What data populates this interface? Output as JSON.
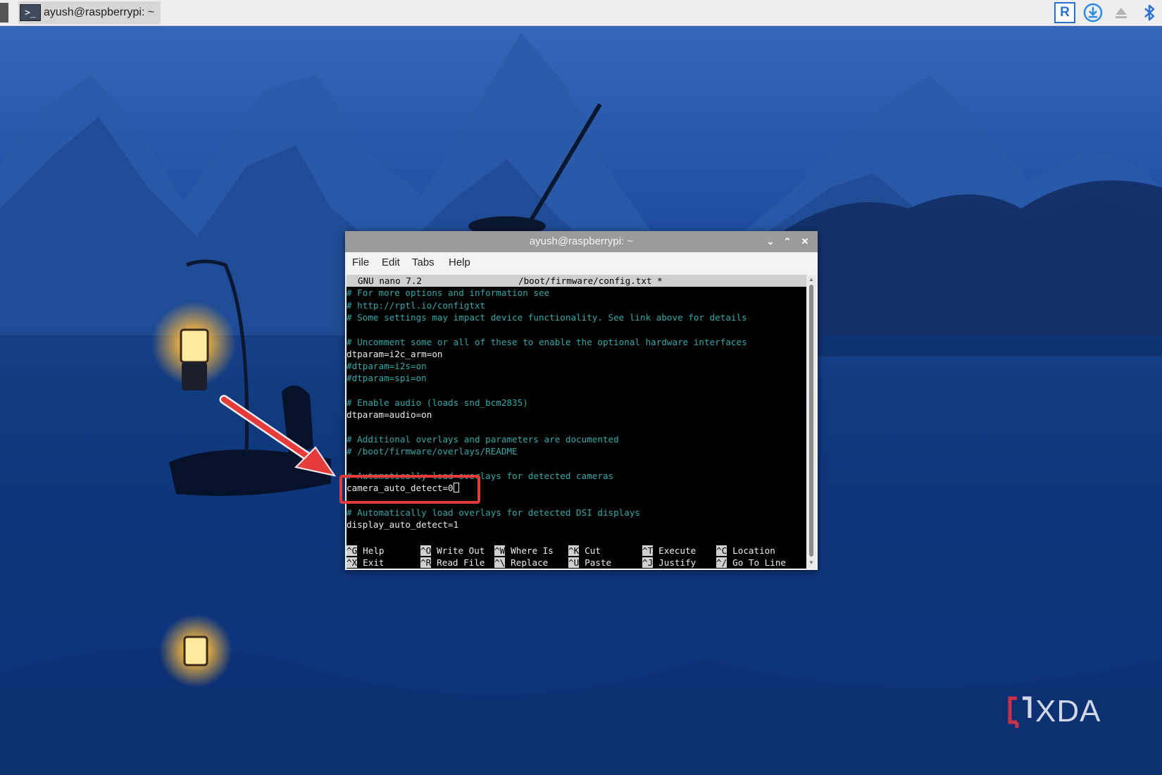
{
  "taskbar": {
    "task_label": "ayush@raspberrypi: ~",
    "task_icon_glyph": ">_",
    "tray_icons": [
      "vnc-icon",
      "updater-icon",
      "eject-icon",
      "bluetooth-icon"
    ],
    "vnc_glyph": "R"
  },
  "window": {
    "title": "ayush@raspberrypi: ~",
    "controls": {
      "minimize": "⌄",
      "maximize": "⌃",
      "close": "✕"
    },
    "menu": [
      "File",
      "Edit",
      "Tabs",
      "Help"
    ]
  },
  "nano": {
    "header_left": "GNU nano 7.2",
    "header_file": "/boot/firmware/config.txt *",
    "lines": [
      {
        "text": "# For more options and information see",
        "type": "comment"
      },
      {
        "text": "# http://rptl.io/configtxt",
        "type": "comment"
      },
      {
        "text": "# Some settings may impact device functionality. See link above for details",
        "type": "comment"
      },
      {
        "text": "",
        "type": "blank"
      },
      {
        "text": "# Uncomment some or all of these to enable the optional hardware interfaces",
        "type": "comment"
      },
      {
        "text": "dtparam=i2c_arm=on",
        "type": "code"
      },
      {
        "text": "#dtparam=i2s=on",
        "type": "comment"
      },
      {
        "text": "#dtparam=spi=on",
        "type": "comment"
      },
      {
        "text": "",
        "type": "blank"
      },
      {
        "text": "# Enable audio (loads snd_bcm2835)",
        "type": "comment"
      },
      {
        "text": "dtparam=audio=on",
        "type": "code"
      },
      {
        "text": "",
        "type": "blank"
      },
      {
        "text": "# Additional overlays and parameters are documented",
        "type": "comment"
      },
      {
        "text": "# /boot/firmware/overlays/README",
        "type": "comment"
      },
      {
        "text": "",
        "type": "blank"
      },
      {
        "text": "# Automatically load overlays for detected cameras",
        "type": "comment"
      },
      {
        "text": "camera_auto_detect=0",
        "type": "code"
      },
      {
        "text": "",
        "type": "blank"
      },
      {
        "text": "# Automatically load overlays for detected DSI displays",
        "type": "comment"
      },
      {
        "text": "display_auto_detect=1",
        "type": "code"
      }
    ],
    "shortcuts": [
      {
        "key": "^G",
        "label": "Help"
      },
      {
        "key": "^O",
        "label": "Write Out"
      },
      {
        "key": "^W",
        "label": "Where Is"
      },
      {
        "key": "^K",
        "label": "Cut"
      },
      {
        "key": "^T",
        "label": "Execute"
      },
      {
        "key": "^C",
        "label": "Location"
      },
      {
        "key": "^X",
        "label": "Exit"
      },
      {
        "key": "^R",
        "label": "Read File"
      },
      {
        "key": "^\\",
        "label": "Replace"
      },
      {
        "key": "^U",
        "label": "Paste"
      },
      {
        "key": "^J",
        "label": "Justify"
      },
      {
        "key": "^/",
        "label": "Go To Line"
      }
    ]
  },
  "watermark": {
    "text": "XDA"
  },
  "colors": {
    "comment": "#35a8a8",
    "highlight": "#e53b3b",
    "arrow": "#e53b3b",
    "titlebar": "#9b9b9b"
  }
}
